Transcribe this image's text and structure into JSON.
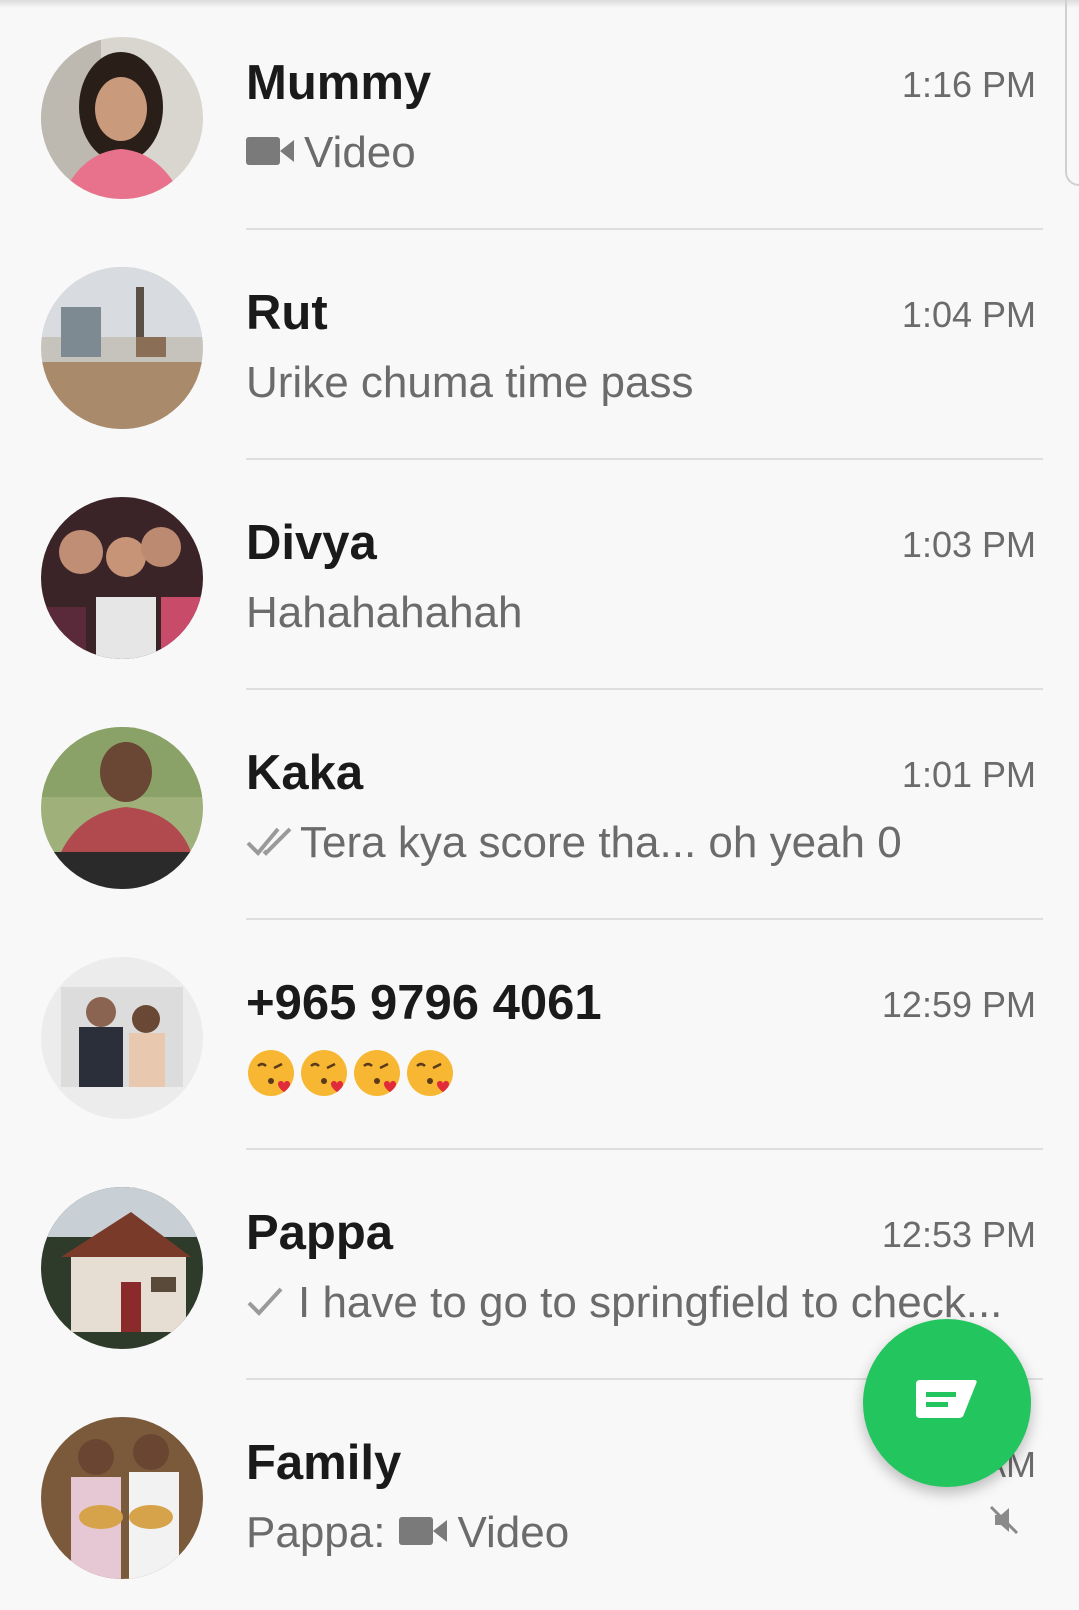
{
  "chats": [
    {
      "name": "Mummy",
      "time": "1:16 PM",
      "preview": "Video",
      "preview_icon": "video-camera-icon",
      "status": "none"
    },
    {
      "name": "Rut",
      "time": "1:04 PM",
      "preview": "Urike chuma time pass",
      "status": "none"
    },
    {
      "name": "Divya",
      "time": "1:03 PM",
      "preview": "Hahahahahah",
      "status": "none"
    },
    {
      "name": "Kaka",
      "time": "1:01 PM",
      "preview": "Tera kya score tha... oh yeah 0",
      "status": "double-check-icon"
    },
    {
      "name": "+965 9796 4061",
      "time": "12:59 PM",
      "preview": "😘😘😘😘",
      "preview_kind": "emoji",
      "emoji_count": 4,
      "status": "none"
    },
    {
      "name": "Pappa",
      "time": "12:53 PM",
      "preview": "I have to go to springfield to check...",
      "status": "single-check-icon"
    },
    {
      "name": "Family",
      "time": "AM",
      "preview_sender": "Pappa:",
      "preview": "Video",
      "preview_icon": "video-camera-icon",
      "muted": true
    }
  ],
  "fab": {
    "icon": "new-message-icon",
    "color": "#22c55e"
  },
  "colors": {
    "name": "#1a1a1a",
    "secondary": "#6b6b6b",
    "divider": "#dedede",
    "background": "#f8f8f8"
  }
}
